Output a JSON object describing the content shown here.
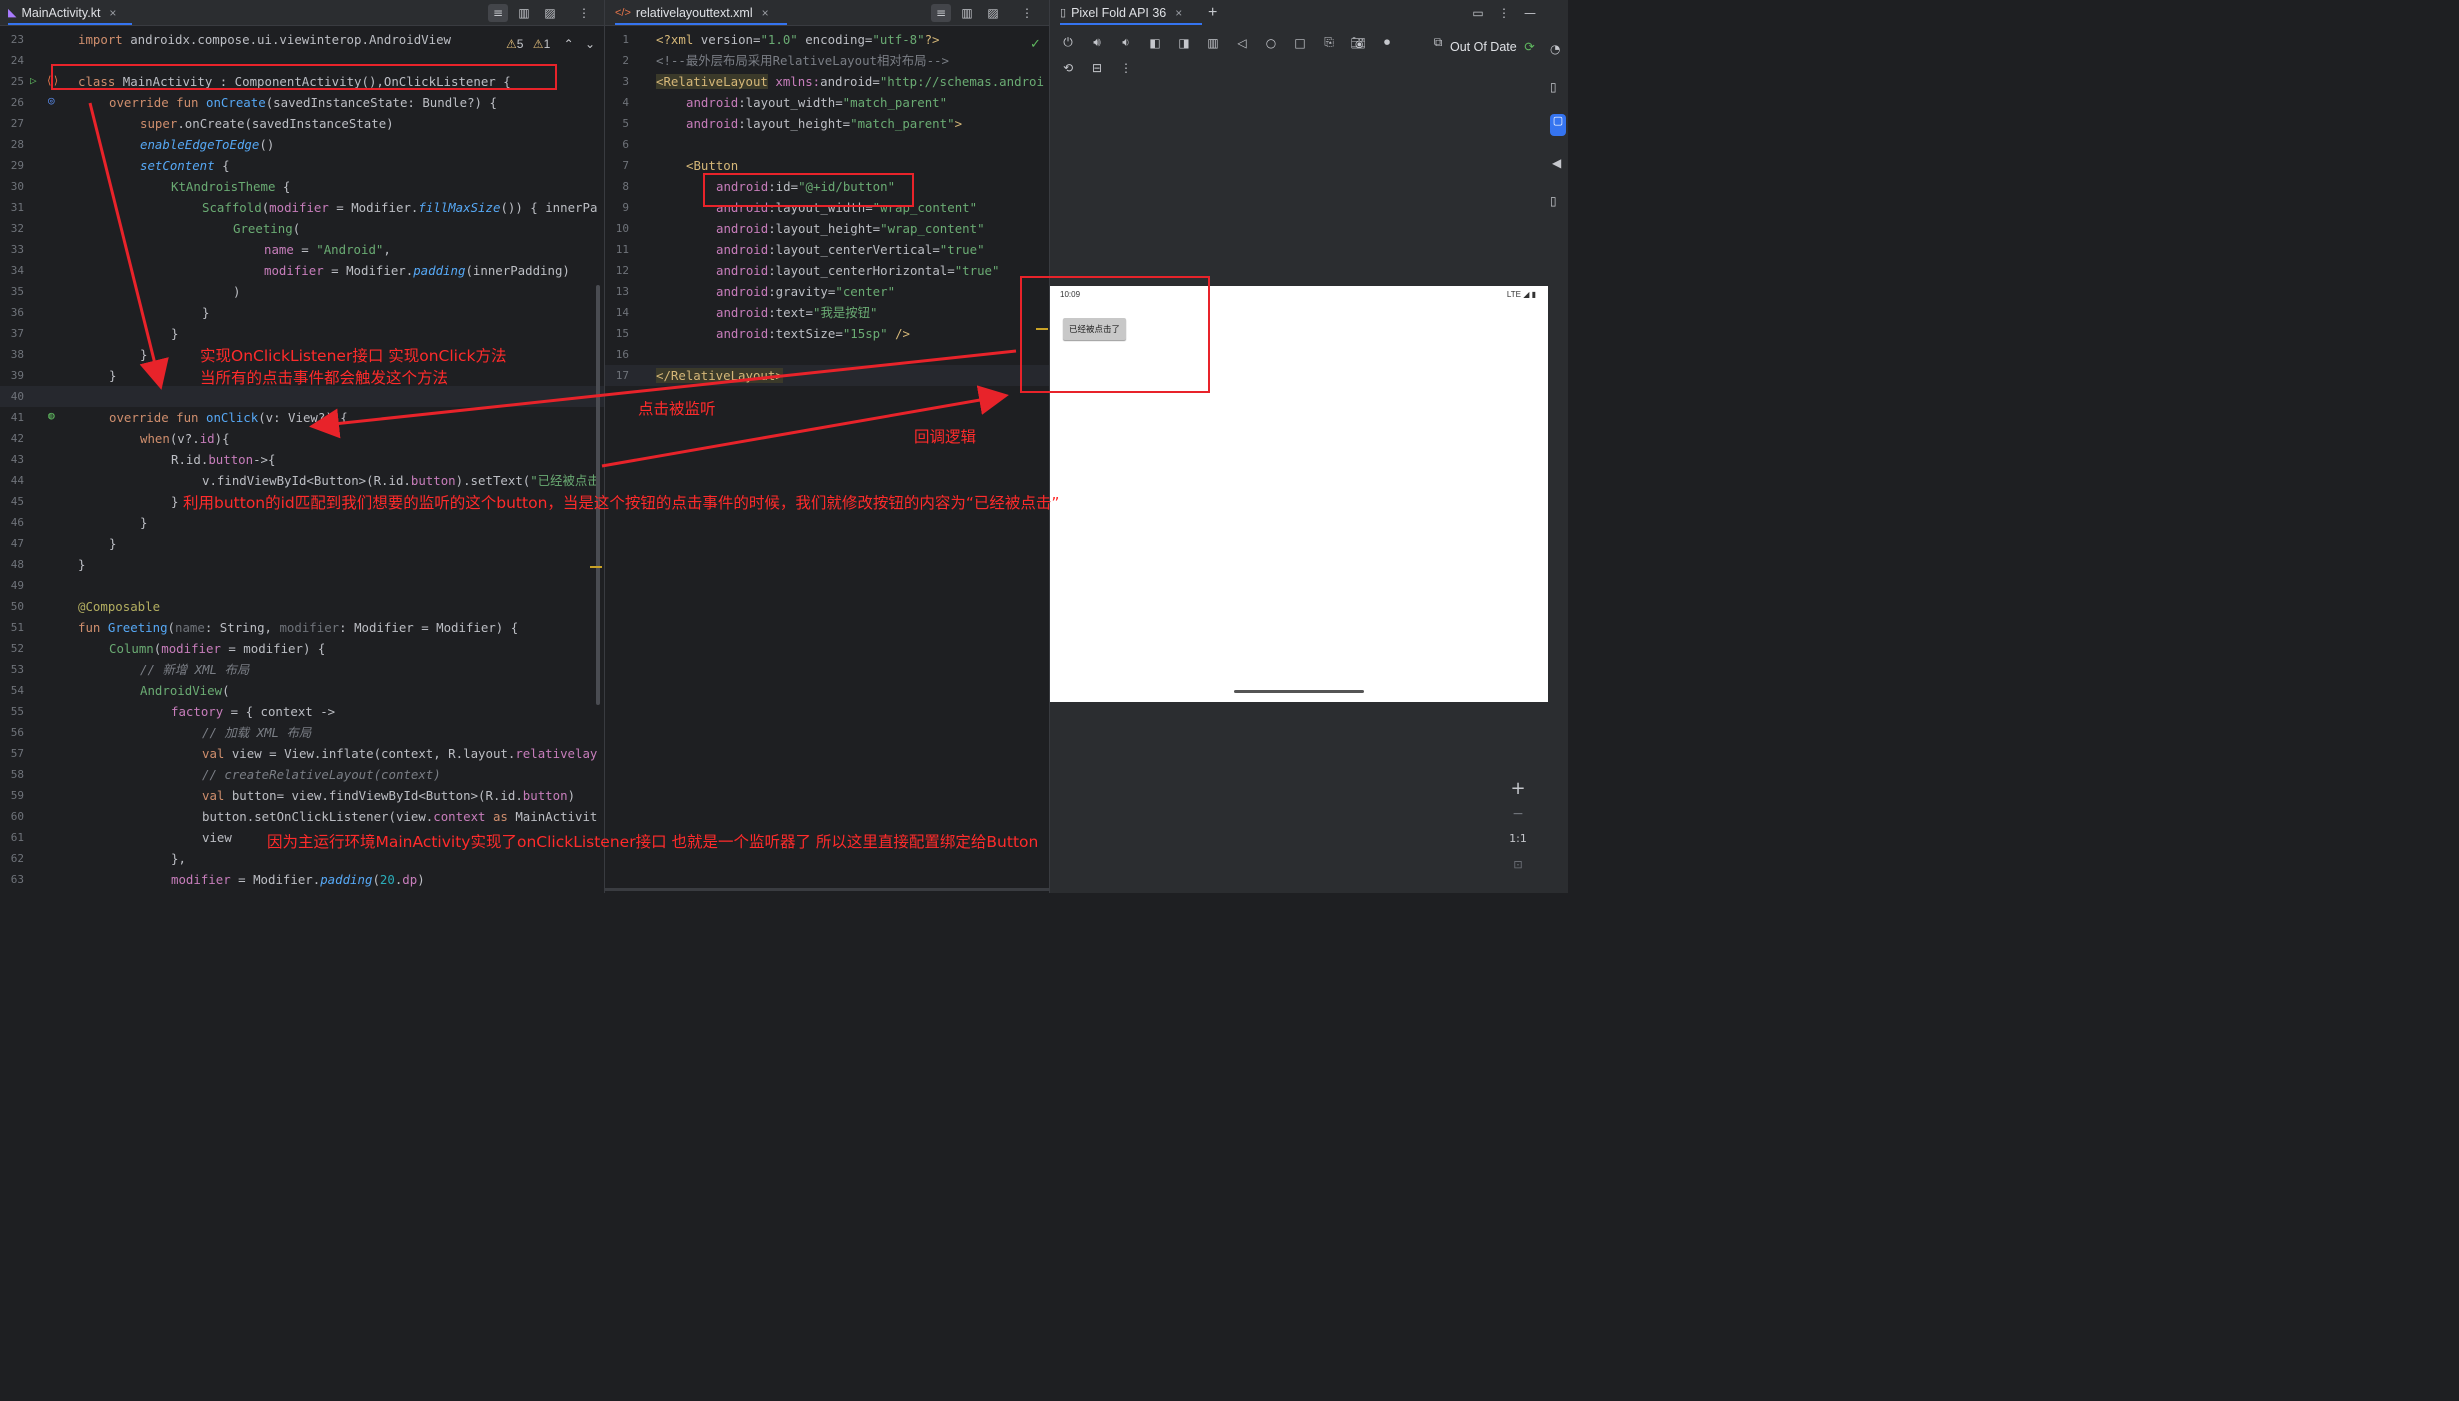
{
  "left_tab": {
    "icon": "kotlin-file-icon",
    "title": "MainActivity.kt",
    "close": "×"
  },
  "left_toolbar": [
    "≡",
    "▥",
    "▨",
    "⋮"
  ],
  "inspections": {
    "warnings": "5",
    "weak": "1"
  },
  "kotlin_lines": [
    {
      "n": "23",
      "html": "<span class='kw'>import</span> androidx.compose.ui.viewinterop.AndroidView",
      "x": 0
    },
    {
      "n": "24",
      "html": "",
      "x": 0
    },
    {
      "n": "25",
      "html": "<span class='kw'>class</span> MainActivity : ComponentActivity(),OnClickListener {",
      "x": 0
    },
    {
      "n": "26",
      "html": "<span class='kw'>override fun</span> <span class='fn'>onCreate</span>(savedInstanceState: Bundle?) {",
      "x": 1
    },
    {
      "n": "27",
      "html": "<span class='kw'>super</span>.onCreate(savedInstanceState)",
      "x": 2
    },
    {
      "n": "28",
      "html": "<span class='it'>enableEdgeToEdge</span>()",
      "x": 2
    },
    {
      "n": "29",
      "html": "<span class='it'>setContent</span> {",
      "x": 2
    },
    {
      "n": "30",
      "html": "<span class='st'>KtAndroisTheme</span> {",
      "x": 3
    },
    {
      "n": "31",
      "html": "<span class='st'>Scaffold</span>(<span class='pr'>modifier</span> = Modifier.<span class='it'>fillMaxSize</span>()) { innerPa",
      "x": 4
    },
    {
      "n": "32",
      "html": "<span class='st'>Greeting</span>(",
      "x": 5
    },
    {
      "n": "33",
      "html": "<span class='pr'>name</span> = <span class='st'>\"Android\"</span>,",
      "x": 6
    },
    {
      "n": "34",
      "html": "<span class='pr'>modifier</span> = Modifier.<span class='it'>padding</span>(innerPadding)",
      "x": 6
    },
    {
      "n": "35",
      "html": ")",
      "x": 5
    },
    {
      "n": "36",
      "html": "}",
      "x": 4
    },
    {
      "n": "37",
      "html": "}",
      "x": 3
    },
    {
      "n": "38",
      "html": "}",
      "x": 2
    },
    {
      "n": "39",
      "html": "}",
      "x": 1
    },
    {
      "n": "40",
      "html": "",
      "x": 0
    },
    {
      "n": "41",
      "html": "<span class='kw'>override fun</span> <span class='fn'>onClick</span>(v: View?) {",
      "x": 1
    },
    {
      "n": "42",
      "html": "<span class='kw'>when</span>(v?.<span class='pr'>id</span>){",
      "x": 2
    },
    {
      "n": "43",
      "html": "R.id.<span class='pr'>button</span>->{",
      "x": 3
    },
    {
      "n": "44",
      "html": "v.findViewById&lt;Button&gt;(R.id.<span class='pr'>button</span>).setText(<span class='st'>\"已经被点击</span>",
      "x": 4
    },
    {
      "n": "45",
      "html": "}",
      "x": 3
    },
    {
      "n": "46",
      "html": "}",
      "x": 2
    },
    {
      "n": "47",
      "html": "}",
      "x": 1
    },
    {
      "n": "48",
      "html": "}",
      "x": 0
    },
    {
      "n": "49",
      "html": "",
      "x": 0
    },
    {
      "n": "50",
      "html": "<span class='an'>@Composable</span>",
      "x": 0
    },
    {
      "n": "51",
      "html": "<span class='kw'>fun</span> <span class='fn'>Greeting</span>(<span class='pm'>name</span>: String, <span class='pm'>modifier</span>: Modifier = Modifier) {",
      "x": 0
    },
    {
      "n": "52",
      "html": "<span class='st'>Column</span>(<span class='pr'>modifier</span> = modifier) {",
      "x": 1
    },
    {
      "n": "53",
      "html": "<span class='cm'>// 新增 XML 布局</span>",
      "x": 2
    },
    {
      "n": "54",
      "html": "<span class='st'>AndroidView</span>(",
      "x": 2
    },
    {
      "n": "55",
      "html": "<span class='pr'>factory</span> = { context ->",
      "x": 3
    },
    {
      "n": "56",
      "html": "<span class='cm'>// 加载 XML 布局</span>",
      "x": 4
    },
    {
      "n": "57",
      "html": "<span class='kw'>val</span> view = View.inflate(context, R.layout.<span class='pr'>relativelay</span>",
      "x": 4
    },
    {
      "n": "58",
      "html": "<span class='cm'>// createRelativeLayout(context)</span>",
      "x": 4
    },
    {
      "n": "59",
      "html": "<span class='kw'>val</span> button= view.findViewById&lt;Button&gt;(R.id.<span class='pr'>button</span>)",
      "x": 4
    },
    {
      "n": "60",
      "html": "button.setOnClickListener(view.<span class='pr'>context</span> <span class='kw'>as</span> MainActivit",
      "x": 4
    },
    {
      "n": "61",
      "html": "view",
      "x": 4
    },
    {
      "n": "62",
      "html": "},",
      "x": 3
    },
    {
      "n": "63",
      "html": "<span class='pr'>modifier</span> = Modifier.<span class='it'>padding</span>(<span class='nm'>20</span>.<span class='pr'>dp</span>)",
      "x": 3
    }
  ],
  "mid_tab": {
    "icon": "xml-file-icon",
    "title": "relativelayouttext.xml",
    "close": "×"
  },
  "mid_toolbar": [
    "≡",
    "▥",
    "▨",
    "⋮"
  ],
  "xml_lines": [
    {
      "n": "1",
      "html": "<span class='xtag'>&lt;?xml</span> version=<span class='xval'>\"1.0\"</span> encoding=<span class='xval'>\"utf-8\"</span><span class='xtag'>?&gt;</span>",
      "x": 0
    },
    {
      "n": "2",
      "html": "<span class='xcm'>&lt;!--最外层布局采用RelativeLayout相对布局--&gt;</span>",
      "x": 0
    },
    {
      "n": "3",
      "html": "<span class='xtag' style='background:#3b3a2a'>&lt;RelativeLayout</span> <span class='xns'>xmlns:</span><span class='xattr'>android</span>=<span class='xval'>\"http://schemas.androi</span>",
      "x": 0
    },
    {
      "n": "4",
      "html": "<span class='xns'>android</span>:layout_width=<span class='xval'>\"match_parent\"</span>",
      "x": 1
    },
    {
      "n": "5",
      "html": "<span class='xns'>android</span>:layout_height=<span class='xval'>\"match_parent\"</span><span class='xtag'>&gt;</span>",
      "x": 1
    },
    {
      "n": "6",
      "html": "",
      "x": 0
    },
    {
      "n": "7",
      "html": "<span class='xtag'>&lt;Button</span>",
      "x": 1
    },
    {
      "n": "8",
      "html": "<span class='xns'>android</span>:id=<span class='xval'>\"@+id/button\"</span>",
      "x": 2
    },
    {
      "n": "9",
      "html": "<span class='xns'>android</span>:layout_width=<span class='xval'>\"wrap_content\"</span>",
      "x": 2
    },
    {
      "n": "10",
      "html": "<span class='xns'>android</span>:layout_height=<span class='xval'>\"wrap_content\"</span>",
      "x": 2
    },
    {
      "n": "11",
      "html": "<span class='xns'>android</span>:layout_centerVertical=<span class='xval'>\"true\"</span>",
      "x": 2
    },
    {
      "n": "12",
      "html": "<span class='xns'>android</span>:layout_centerHorizontal=<span class='xval'>\"true\"</span>",
      "x": 2
    },
    {
      "n": "13",
      "html": "<span class='xns'>android</span>:gravity=<span class='xval'>\"center\"</span>",
      "x": 2
    },
    {
      "n": "14",
      "html": "<span class='xns'>android</span>:text=<span class='xval'>\"我是按钮\"</span>",
      "x": 2
    },
    {
      "n": "15",
      "html": "<span class='xns'>android</span>:textSize=<span class='xval'>\"15sp\"</span> <span class='xtag'>/&gt;</span>",
      "x": 2
    },
    {
      "n": "16",
      "html": "",
      "x": 0
    },
    {
      "n": "17",
      "html": "<span class='xtag' style='background:#3b3a2a'>&lt;/RelativeLayout&gt;</span>",
      "x": 0
    }
  ],
  "device_tab": {
    "icon": "device-icon",
    "title": "Pixel Fold API 36",
    "close": "×",
    "add": "+"
  },
  "emulator": {
    "status": "Out Of Date",
    "zoom_plus": "+",
    "zoom_minus": "−",
    "zoom_ratio": "1:1"
  },
  "phone": {
    "time": "10:09",
    "network": "LTE",
    "button_text": "已经被点击了"
  },
  "annotations": {
    "impl_1": "实现OnClickListener接口 实现onClick方法",
    "impl_2": "当所有的点击事件都会触发这个方法",
    "listened": "点击被监听",
    "callback": "回调逻辑",
    "id_match": "利用button的id匹配到我们想要的监听的这个button，当是这个按钮的点击事件的时候，我们就修改按钮的内容为“已经被点击”",
    "bind": "因为主运行环境MainActivity实现了onClickListener接口 也就是一个监听器了 所以这里直接配置绑定给Button"
  },
  "colors": {
    "annotation": "#ff2b2b",
    "accent": "#3574f0",
    "editor_bg": "#1e1f22"
  }
}
